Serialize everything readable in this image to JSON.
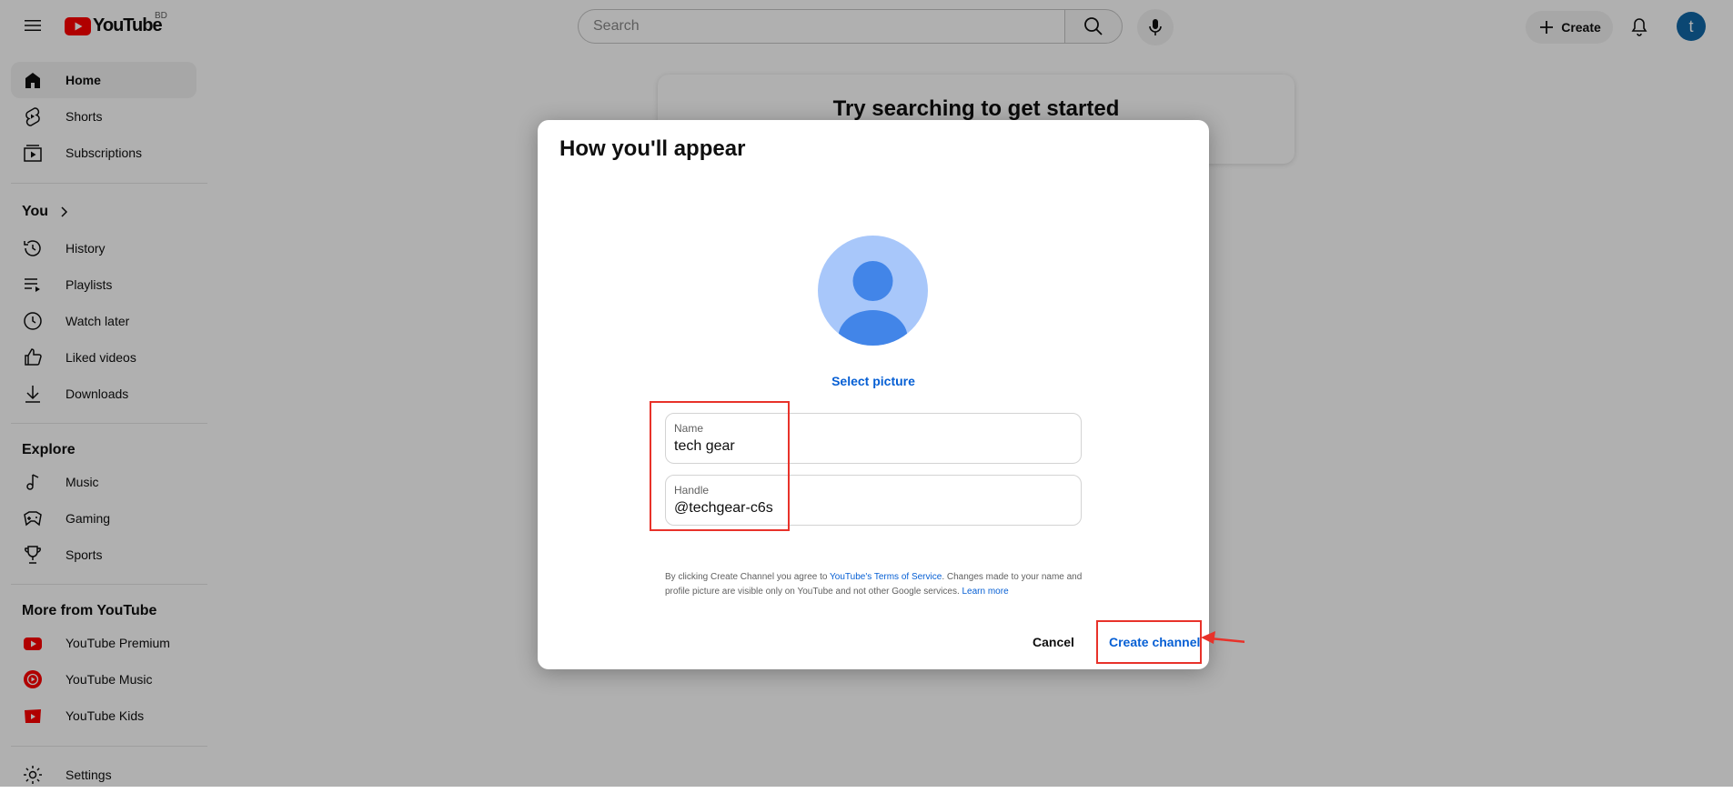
{
  "masthead": {
    "logo_text": "YouTube",
    "country_code": "BD",
    "search_placeholder": "Search",
    "create_label": "Create",
    "avatar_letter": "t"
  },
  "sidebar": {
    "main": [
      {
        "label": "Home",
        "icon": "home-icon",
        "active": true
      },
      {
        "label": "Shorts",
        "icon": "shorts-icon"
      },
      {
        "label": "Subscriptions",
        "icon": "subscriptions-icon"
      }
    ],
    "you_heading": "You",
    "you_items": [
      {
        "label": "History",
        "icon": "history-icon"
      },
      {
        "label": "Playlists",
        "icon": "playlists-icon"
      },
      {
        "label": "Watch later",
        "icon": "watch-later-icon"
      },
      {
        "label": "Liked videos",
        "icon": "liked-videos-icon"
      },
      {
        "label": "Downloads",
        "icon": "downloads-icon"
      }
    ],
    "explore_heading": "Explore",
    "explore_items": [
      {
        "label": "Music",
        "icon": "music-icon"
      },
      {
        "label": "Gaming",
        "icon": "gaming-icon"
      },
      {
        "label": "Sports",
        "icon": "sports-icon"
      }
    ],
    "more_heading": "More from YouTube",
    "more_items": [
      {
        "label": "YouTube Premium",
        "icon": "youtube-premium-icon"
      },
      {
        "label": "YouTube Music",
        "icon": "youtube-music-icon"
      },
      {
        "label": "YouTube Kids",
        "icon": "youtube-kids-icon"
      }
    ],
    "settings_label": "Settings"
  },
  "main": {
    "prompt_title": "Try searching to get started"
  },
  "dialog": {
    "title": "How you'll appear",
    "select_picture": "Select picture",
    "name_label": "Name",
    "name_value": "tech gear",
    "handle_label": "Handle",
    "handle_value": "@techgear-c6s",
    "terms_prefix": "By clicking Create Channel you agree to ",
    "terms_link": "YouTube's Terms of Service",
    "terms_middle": ". Changes made to your name and profile picture are visible only on YouTube and not other Google services. ",
    "learn_more": "Learn more",
    "cancel_label": "Cancel",
    "create_label": "Create channel"
  },
  "colors": {
    "accent_blue": "#065fd4",
    "highlight_red": "#e8322a",
    "youtube_red": "#ff0000"
  }
}
